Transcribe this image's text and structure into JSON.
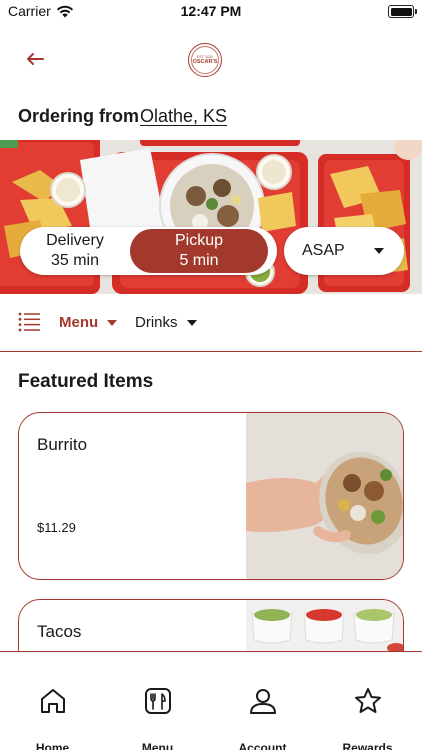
{
  "status_bar": {
    "carrier": "Carrier",
    "time": "12:47 PM"
  },
  "header": {
    "logo_top": "EST. 2011",
    "logo_name": "OSCAR'S"
  },
  "ordering": {
    "label": "Ordering from",
    "location": "Olathe, KS"
  },
  "order_mode": {
    "delivery": {
      "label": "Delivery",
      "time": "35 min"
    },
    "pickup": {
      "label": "Pickup",
      "time": "5 min",
      "selected": true
    },
    "when": "ASAP"
  },
  "categories": {
    "menu": "Menu",
    "drinks": "Drinks",
    "active": "Menu"
  },
  "featured": {
    "heading": "Featured Items",
    "items": [
      {
        "name": "Burrito",
        "price": "$11.29"
      },
      {
        "name": "Tacos"
      }
    ]
  },
  "tabs": [
    {
      "label": "Home",
      "icon": "home-icon"
    },
    {
      "label": "Menu",
      "icon": "menu-utensils-icon"
    },
    {
      "label": "Account",
      "icon": "account-icon"
    },
    {
      "label": "Rewards",
      "icon": "star-icon"
    }
  ],
  "colors": {
    "accent": "#a3392c",
    "text": "#1a1a1a",
    "background": "#ffffff"
  }
}
